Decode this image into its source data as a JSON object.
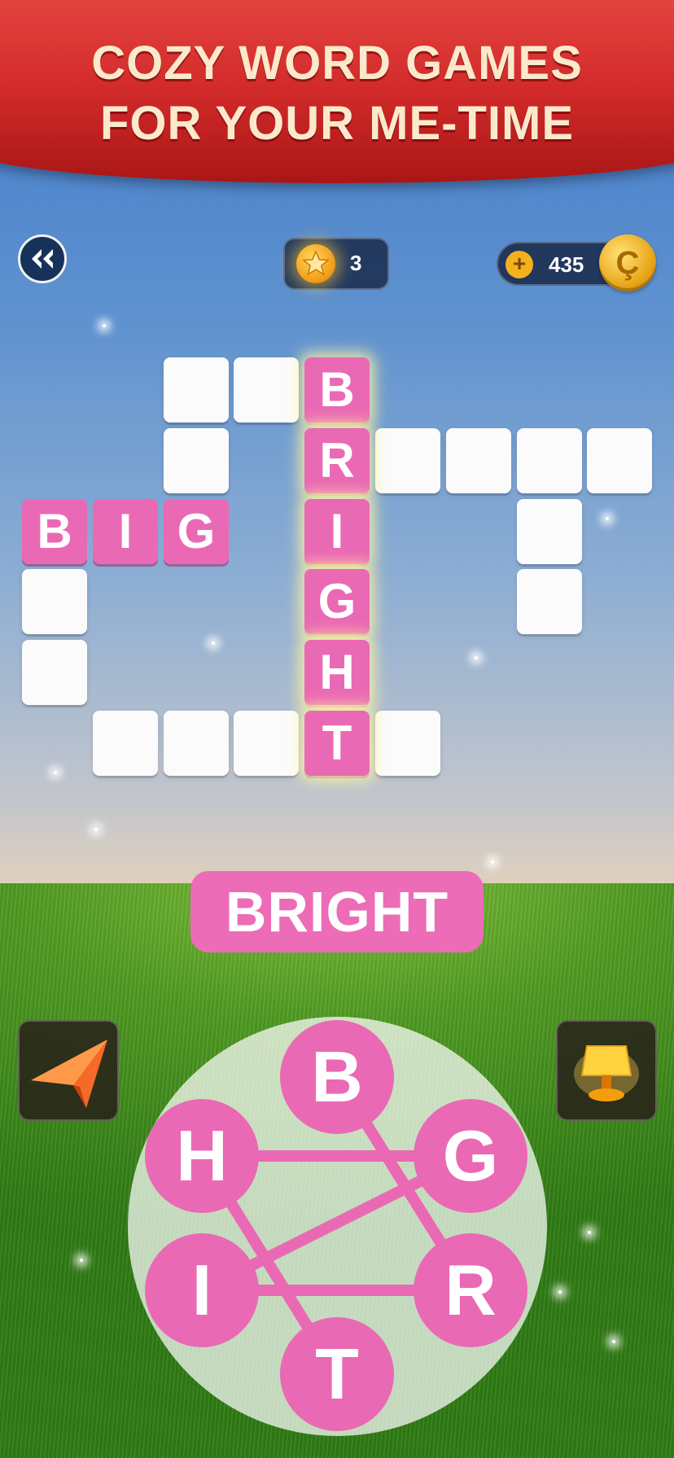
{
  "banner": {
    "line1": "COZY WORD GAMES",
    "line2": "FOR YOUR ME-TIME"
  },
  "hud": {
    "back_icon": "double-chevron-left-icon",
    "stars": "3",
    "star_icon": "star-icon",
    "coins": "435",
    "plus_icon": "plus-icon",
    "coin_symbol": "Ç"
  },
  "crossword": {
    "words_found": [
      "BRIGHT",
      "BIG"
    ],
    "letters": {
      "bright_b": "B",
      "bright_r": "R",
      "bright_i": "I",
      "bright_g": "G",
      "bright_h": "H",
      "bright_t": "T",
      "big_b": "B",
      "big_i": "I",
      "big_g": "G"
    }
  },
  "current_word": "BRIGHT",
  "tools": {
    "left": "paper-plane-icon",
    "right": "lamp-icon"
  },
  "wheel": {
    "letters": {
      "top": "B",
      "upper_right": "G",
      "lower_right": "R",
      "bottom": "T",
      "lower_left": "I",
      "upper_left": "H"
    }
  },
  "colors": {
    "tile_pink": "#ea69b4",
    "banner_red": "#d22a2a",
    "banner_text": "#fbe9cc"
  }
}
